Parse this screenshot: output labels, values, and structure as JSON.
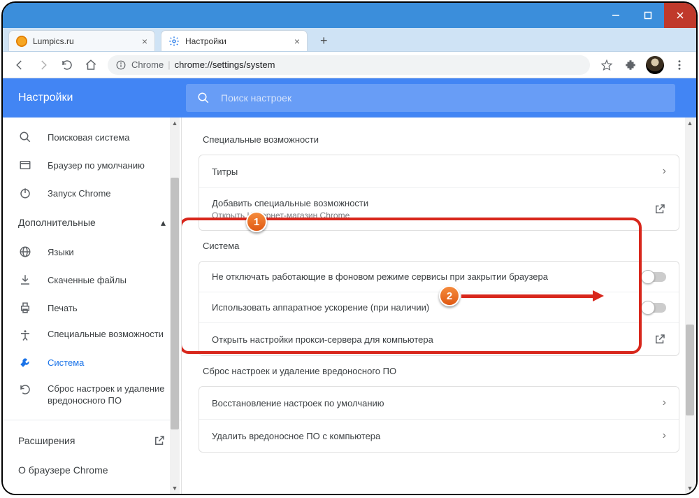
{
  "window": {
    "tabs": [
      {
        "title": "Lumpics.ru",
        "active": false
      },
      {
        "title": "Настройки",
        "active": true
      }
    ]
  },
  "omnibox": {
    "prefix": "Chrome",
    "path": "chrome://settings/system"
  },
  "settings": {
    "heading": "Настройки",
    "search_placeholder": "Поиск настроек",
    "sidebar": {
      "items": [
        {
          "icon": "search",
          "label": "Поисковая система"
        },
        {
          "icon": "browser",
          "label": "Браузер по умолчанию"
        },
        {
          "icon": "power",
          "label": "Запуск Chrome"
        }
      ],
      "advanced_label": "Дополнительные",
      "advanced_items": [
        {
          "icon": "globe",
          "label": "Языки"
        },
        {
          "icon": "download",
          "label": "Скаченные файлы"
        },
        {
          "icon": "print",
          "label": "Печать"
        },
        {
          "icon": "a11y",
          "label": "Специальные возможности"
        },
        {
          "icon": "wrench",
          "label": "Система",
          "active": true
        },
        {
          "icon": "reset",
          "label": "Сброс настроек и удаление вредоносного ПО"
        }
      ],
      "extensions_label": "Расширения",
      "about_label": "О браузере Chrome"
    },
    "accessibility": {
      "title": "Специальные возможности",
      "captions": "Титры",
      "add_label": "Добавить специальные возможности",
      "add_sub": "Открыть Интернет-магазин Chrome"
    },
    "system": {
      "title": "Система",
      "background": "Не отключать работающие в фоновом режиме сервисы при закрытии браузера",
      "hwaccel": "Использовать аппаратное ускорение (при наличии)",
      "proxy": "Открыть настройки прокси-сервера для компьютера"
    },
    "reset": {
      "title": "Сброс настроек и удаление вредоносного ПО",
      "restore": "Восстановление настроек по умолчанию",
      "cleanup": "Удалить вредоносное ПО с компьютера"
    }
  },
  "callouts": {
    "one": "1",
    "two": "2"
  }
}
